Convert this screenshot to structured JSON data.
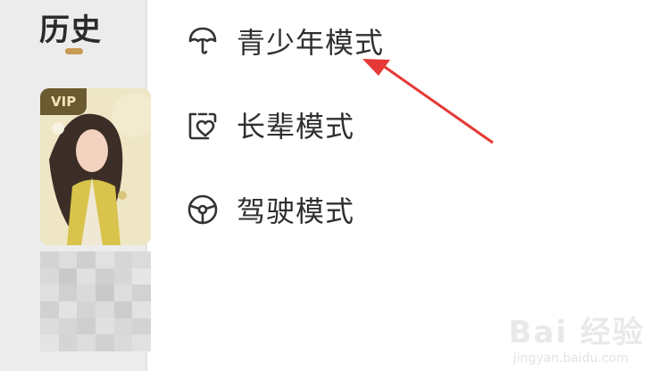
{
  "left_panel": {
    "title": "历史",
    "badge": "VIP"
  },
  "menu": {
    "items": [
      {
        "label": "青少年模式",
        "icon": "umbrella-icon"
      },
      {
        "label": "长辈模式",
        "icon": "elder-heart-icon"
      },
      {
        "label": "驾驶模式",
        "icon": "steering-wheel-icon"
      }
    ]
  },
  "watermark": {
    "brand": "Bai 经验",
    "url": "jingyan.baidu.com"
  },
  "colors": {
    "arrow": "#e53935",
    "title_accent": "#c99a56",
    "vip_bg": "#6b5930"
  }
}
